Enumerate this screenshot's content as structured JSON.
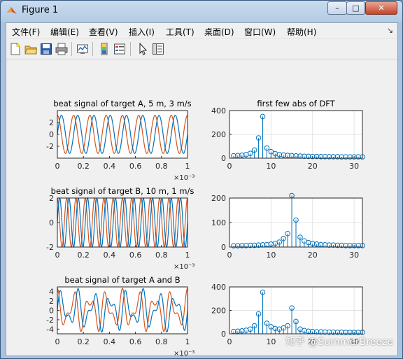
{
  "window": {
    "title": "Figure 1",
    "buttons": {
      "minimize": "–",
      "maximize": "□",
      "close": "✕"
    }
  },
  "menu": [
    {
      "label": "文件(F)"
    },
    {
      "label": "编辑(E)"
    },
    {
      "label": "查看(V)"
    },
    {
      "label": "插入(I)"
    },
    {
      "label": "工具(T)"
    },
    {
      "label": "桌面(D)"
    },
    {
      "label": "窗口(W)"
    },
    {
      "label": "帮助(H)"
    }
  ],
  "menu_overflow": "↘",
  "toolbar_icons": [
    "new-figure-icon",
    "open-file-icon",
    "save-icon",
    "print-icon",
    "link-plot-icon",
    "insert-colorbar-icon",
    "insert-legend-icon",
    "pointer-icon",
    "property-editor-icon"
  ],
  "colors": {
    "blue": "#0072bd",
    "orange": "#d95319",
    "window_bg": "#f0f0f0"
  },
  "watermark": "知乎 @SummerBreeze",
  "chart_data": [
    {
      "type": "line",
      "title": "beat signal of target A, 5 m, 3 m/s",
      "xlim": [
        0,
        0.001
      ],
      "ylim": [
        -4,
        4
      ],
      "xticks": [
        "0",
        "0.2",
        "0.4",
        "0.6",
        "0.8",
        "1"
      ],
      "yticks": [
        "2",
        "0",
        "-2"
      ],
      "ytick_values": [
        2,
        0,
        -2
      ],
      "exponent": "×10⁻³",
      "series": [
        {
          "values_desc": "cosine",
          "amplitude": 3.2,
          "cycles": 8,
          "phase": 0
        },
        {
          "values_desc": "sine",
          "amplitude": 3.2,
          "cycles": 8,
          "phase": -1.5708
        }
      ]
    },
    {
      "type": "bar",
      "subtype": "stem",
      "title": "first few abs of DFT",
      "xlim": [
        0,
        32
      ],
      "ylim": [
        0,
        400
      ],
      "xticks": [
        "0",
        "10",
        "20",
        "30"
      ],
      "yticks": [
        "400",
        "200",
        "0"
      ],
      "ytick_values": [
        400,
        200,
        0
      ],
      "x": [
        1,
        2,
        3,
        4,
        5,
        6,
        7,
        8,
        9,
        10,
        11,
        12,
        13,
        14,
        15,
        16,
        17,
        18,
        19,
        20,
        21,
        22,
        23,
        24,
        25,
        26,
        27,
        28,
        29,
        30,
        31,
        32
      ],
      "values": [
        20,
        22,
        25,
        30,
        40,
        68,
        170,
        350,
        85,
        55,
        38,
        30,
        26,
        23,
        21,
        19,
        17,
        16,
        15,
        14,
        14,
        13,
        13,
        12,
        12,
        12,
        11,
        11,
        11,
        11,
        11,
        11
      ]
    },
    {
      "type": "line",
      "title": "beat signal of target B, 10 m, 1 m/s",
      "xlim": [
        0,
        0.001
      ],
      "ylim": [
        -2,
        2
      ],
      "xticks": [
        "0",
        "0.2",
        "0.4",
        "0.6",
        "0.8",
        "1"
      ],
      "yticks": [
        "2",
        "0",
        "-2"
      ],
      "ytick_values": [
        2,
        0,
        -2
      ],
      "exponent": "×10⁻³",
      "series": [
        {
          "values_desc": "cosine",
          "amplitude": 2,
          "cycles": 14,
          "phase": 0
        },
        {
          "values_desc": "sine",
          "amplitude": 2,
          "cycles": 14,
          "phase": -1.5708
        }
      ]
    },
    {
      "type": "bar",
      "subtype": "stem",
      "title": "",
      "xlim": [
        0,
        32
      ],
      "ylim": [
        0,
        200
      ],
      "xticks": [
        "0",
        "10",
        "20",
        "30"
      ],
      "yticks": [
        "200",
        "100",
        "0"
      ],
      "ytick_values": [
        200,
        100,
        0
      ],
      "x": [
        1,
        2,
        3,
        4,
        5,
        6,
        7,
        8,
        9,
        10,
        11,
        12,
        13,
        14,
        15,
        16,
        17,
        18,
        19,
        20,
        21,
        22,
        23,
        24,
        25,
        26,
        27,
        28,
        29,
        30,
        31,
        32
      ],
      "values": [
        5,
        5,
        6,
        6,
        7,
        7,
        8,
        9,
        10,
        12,
        15,
        20,
        35,
        55,
        210,
        110,
        40,
        25,
        18,
        14,
        12,
        10,
        9,
        8,
        8,
        7,
        7,
        6,
        6,
        6,
        6,
        6
      ]
    },
    {
      "type": "line",
      "title": "beat signal of target A and B",
      "xlim": [
        0,
        0.001
      ],
      "ylim": [
        -5,
        5
      ],
      "xticks": [
        "0",
        "0.2",
        "0.4",
        "0.6",
        "0.8",
        "1"
      ],
      "yticks": [
        "4",
        "2",
        "0",
        "-2",
        "-4"
      ],
      "ytick_values": [
        4,
        2,
        0,
        -2,
        -4
      ],
      "exponent": "×10⁻³",
      "series": [
        {
          "values_desc": "sum of cosines",
          "components": [
            {
              "amplitude": 2.9,
              "cycles": 8,
              "phase": 0
            },
            {
              "amplitude": 1.8,
              "cycles": 14,
              "phase": 0
            }
          ]
        },
        {
          "values_desc": "sum of sines",
          "components": [
            {
              "amplitude": 2.9,
              "cycles": 8,
              "phase": -1.5708
            },
            {
              "amplitude": 1.8,
              "cycles": 14,
              "phase": -1.5708
            }
          ]
        }
      ]
    },
    {
      "type": "bar",
      "subtype": "stem",
      "title": "",
      "xlim": [
        0,
        32
      ],
      "ylim": [
        0,
        400
      ],
      "xticks": [
        "0",
        "10",
        "20",
        "30"
      ],
      "yticks": [
        "400",
        "200",
        "0"
      ],
      "ytick_values": [
        400,
        200,
        0
      ],
      "x": [
        1,
        2,
        3,
        4,
        5,
        6,
        7,
        8,
        9,
        10,
        11,
        12,
        13,
        14,
        15,
        16,
        17,
        18,
        19,
        20,
        21,
        22,
        23,
        24,
        25,
        26,
        27,
        28,
        29,
        30,
        31,
        32
      ],
      "values": [
        20,
        22,
        25,
        30,
        40,
        68,
        170,
        355,
        90,
        60,
        45,
        40,
        50,
        68,
        220,
        105,
        40,
        28,
        22,
        19,
        17,
        16,
        15,
        14,
        14,
        13,
        13,
        12,
        12,
        12,
        12,
        12
      ]
    }
  ]
}
